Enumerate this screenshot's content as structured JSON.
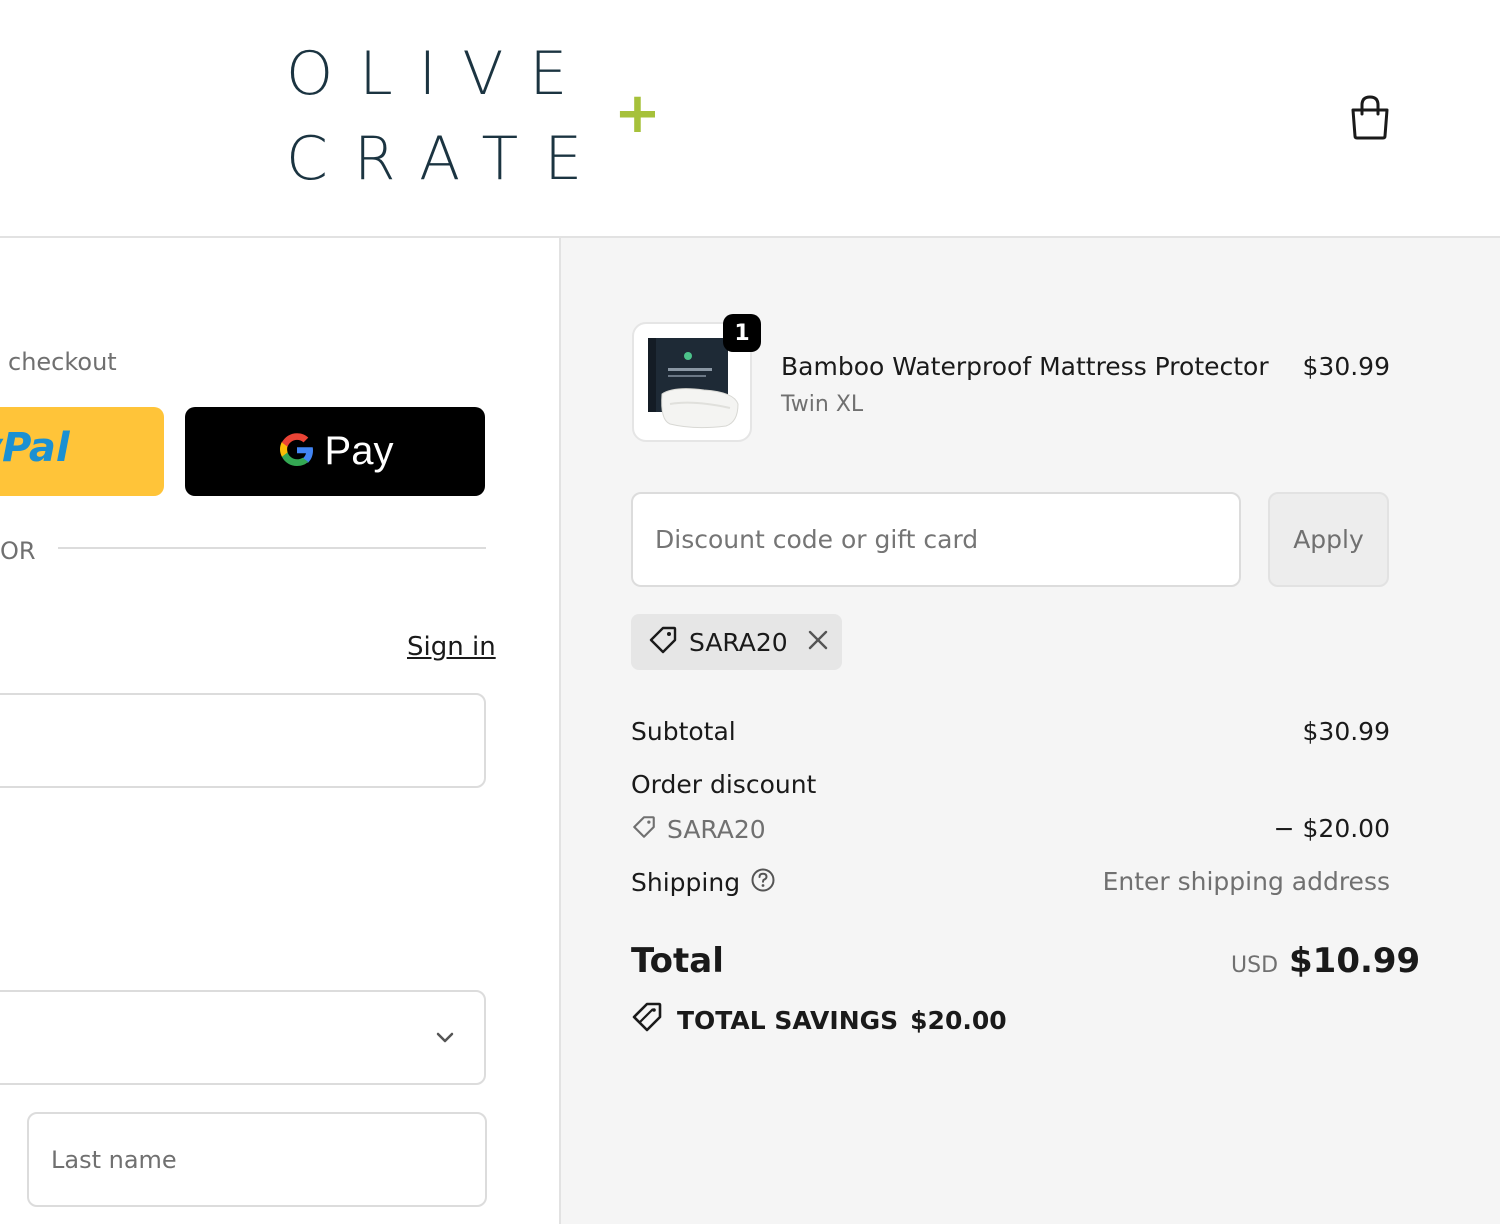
{
  "header": {
    "logo_line1": "OLIVE",
    "logo_line2": "CRATE",
    "logo_plus": "+",
    "cart_icon": "shopping-bag-icon"
  },
  "express_checkout": {
    "label": "checkout",
    "paypal_label": "yPal",
    "gpay_label": "Pay"
  },
  "divider": {
    "or_label": "OR"
  },
  "contact": {
    "sign_in_label": "Sign in"
  },
  "delivery": {
    "last_name_placeholder": "Last name"
  },
  "order": {
    "item": {
      "name": "Bamboo Waterproof Mattress Protector",
      "variant": "Twin XL",
      "price": "$30.99",
      "quantity": "1"
    },
    "discount": {
      "placeholder": "Discount code or gift card",
      "apply_label": "Apply",
      "applied_code": "SARA20"
    },
    "summary": {
      "subtotal_label": "Subtotal",
      "subtotal_value": "$30.99",
      "order_discount_label": "Order discount",
      "discount_code": "SARA20",
      "discount_value": "− $20.00",
      "shipping_label": "Shipping",
      "shipping_value": "Enter shipping address",
      "total_label": "Total",
      "total_currency": "USD",
      "total_value": "$10.99",
      "savings_label": "TOTAL SAVINGS",
      "savings_value": "$20.00"
    }
  },
  "colors": {
    "brand_navy": "#1b3441",
    "brand_green": "#a6c13a",
    "paypal_yellow": "#ffc439",
    "panel_gray": "#f5f5f5"
  }
}
